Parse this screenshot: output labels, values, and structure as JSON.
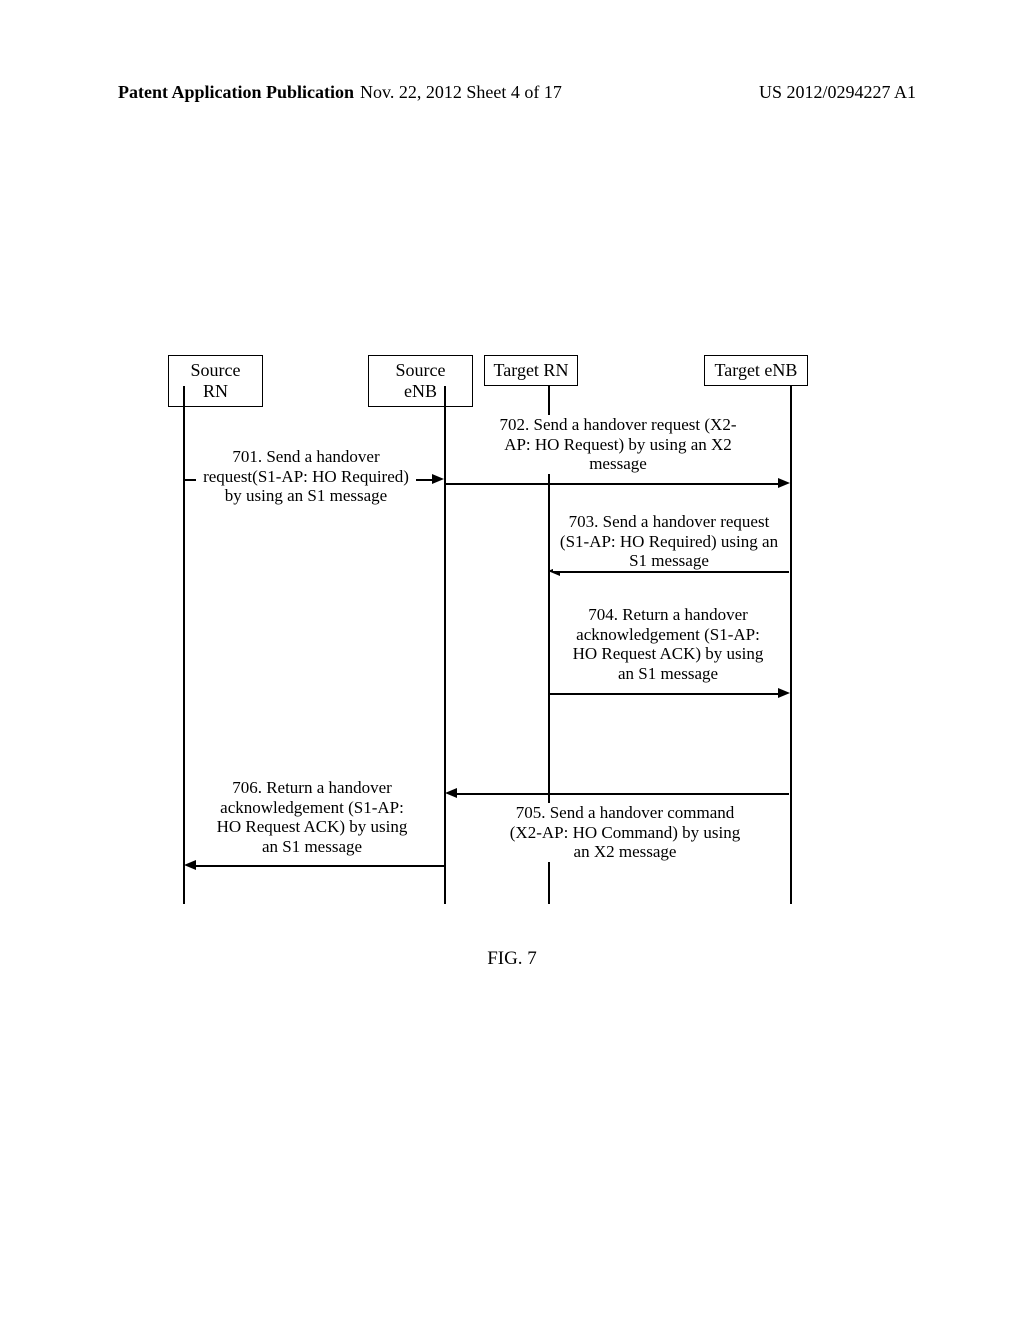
{
  "header": {
    "left": "Patent Application Publication",
    "center": "Nov. 22, 2012  Sheet 4 of 17",
    "right": "US 2012/0294227 A1"
  },
  "nodes": {
    "sourceRN": "Source RN",
    "sourceENB": "Source eNB",
    "targetRN": "Target RN",
    "targetENB": "Target eNB"
  },
  "messages": {
    "m701": "701. Send a handover request(S1-AP: HO Required) by  using an S1 message",
    "m702": "702. Send a handover request (X2-AP: HO Request) by using an X2 message",
    "m703": "703. Send a handover request (S1-AP: HO Required) using an S1 message",
    "m704": "704. Return a handover acknowledgement (S1-AP: HO Request ACK) by using an S1 message",
    "m705": "705. Send a handover command (X2-AP: HO Command) by using an X2 message",
    "m706": "706. Return a handover acknowledgement (S1-AP: HO Request ACK) by using an S1 message"
  },
  "caption": "FIG. 7"
}
